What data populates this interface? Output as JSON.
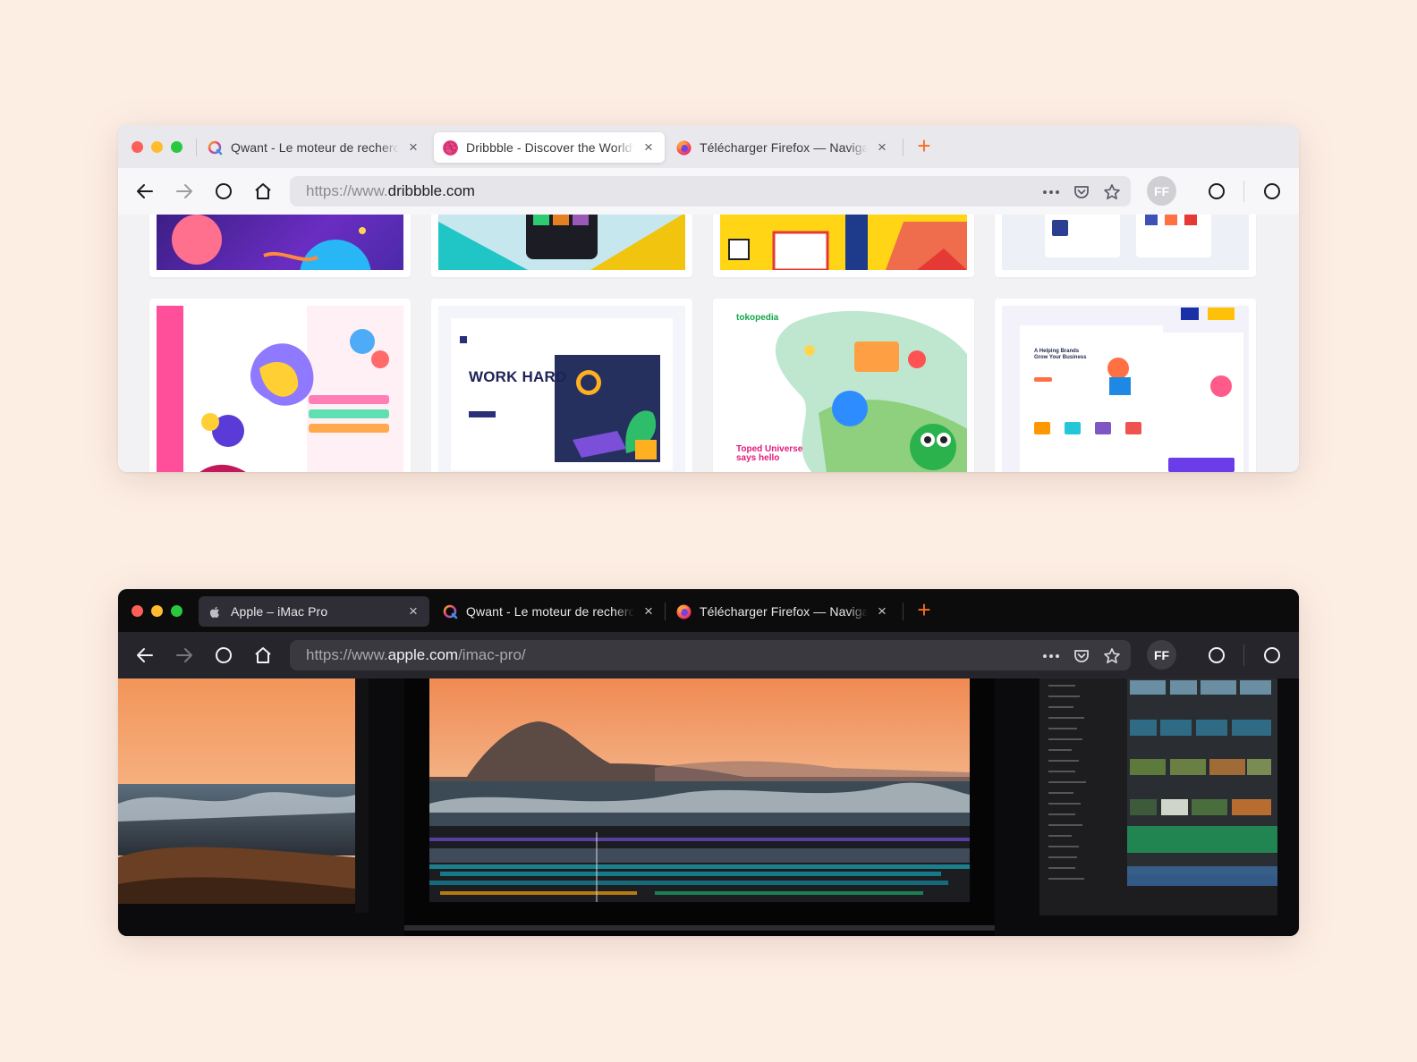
{
  "colors": {
    "background": "#fdeee4",
    "accent": "#ff6a21"
  },
  "windows": [
    {
      "theme": "light",
      "tabs": [
        {
          "title": "Qwant - Le moteur de recherche",
          "icon": "qwant-icon",
          "active": false
        },
        {
          "title": "Dribbble - Discover the World's Top Designers",
          "icon": "dribbble-icon",
          "active": true
        },
        {
          "title": "Télécharger Firefox — Navigateur",
          "icon": "firefox-icon",
          "active": false
        }
      ],
      "url": {
        "prefix": "https://www.",
        "domain": "dribbble.com",
        "path": ""
      },
      "avatar": "FF",
      "shots": {
        "work_hard": "WORK HARD",
        "tokopedia": "tokopedia",
        "toped": "Toped Universe says hello",
        "helping": "A Helping Brands Grow Your Business"
      }
    },
    {
      "theme": "dark",
      "tabs": [
        {
          "title": "Apple – iMac Pro",
          "icon": "apple-icon",
          "active": true
        },
        {
          "title": "Qwant - Le moteur de recherche",
          "icon": "qwant-icon",
          "active": false
        },
        {
          "title": "Télécharger Firefox — Navigateur",
          "icon": "firefox-icon",
          "active": false
        }
      ],
      "url": {
        "prefix": "https://www.",
        "domain": "apple.com",
        "path": "/imac-pro/"
      },
      "avatar": "FF"
    }
  ]
}
